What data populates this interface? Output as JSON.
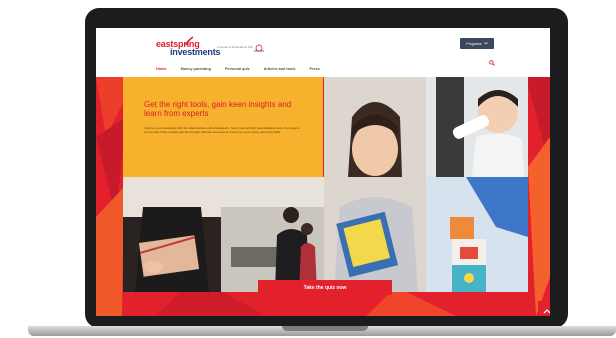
{
  "header": {
    "brand_line1": "eastspring",
    "brand_line2": "investments",
    "tagline": "A member of Prudential plc (UK)",
    "cta_label": "Programs",
    "cta_icon": "chevron-down-icon"
  },
  "nav": {
    "items": [
      {
        "label": "Home",
        "active": true
      },
      {
        "label": "Money parenting",
        "active": false
      },
      {
        "label": "Personal quiz",
        "active": false
      },
      {
        "label": "Articles and tools",
        "active": false
      },
      {
        "label": "Press",
        "active": false
      }
    ],
    "search_icon": "search-icon"
  },
  "hero": {
    "title": "Get the right tools, gain keen insights and learn from experts",
    "body": "Improve your knowledge with the latest articles and whitepapers. Test it yourself with downloadable tools. And meet a community of like-minded parents through webinars and events to level up your money parenting skills.",
    "quiz_button": "Take the quiz now",
    "scroll_icon": "chevron-up-icon"
  },
  "colors": {
    "brand_red": "#e2212c",
    "brand_navy": "#1f3b7a",
    "hero_yellow": "#f7b12c",
    "button_dark": "#3a4a5c"
  }
}
